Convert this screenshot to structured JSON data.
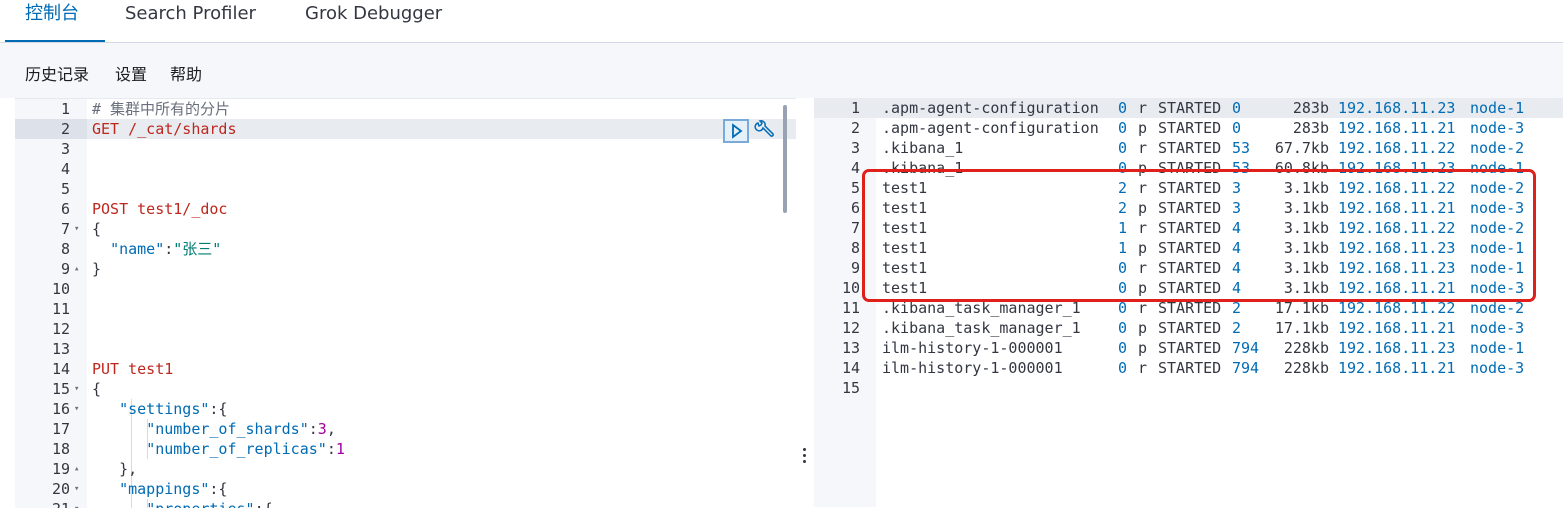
{
  "tabs": [
    {
      "label": "控制台",
      "active": true
    },
    {
      "label": "Search Profiler",
      "active": false
    },
    {
      "label": "Grok Debugger",
      "active": false
    }
  ],
  "menu": {
    "history": "历史记录",
    "settings": "设置",
    "help": "帮助"
  },
  "editor": {
    "lines": [
      {
        "n": "1",
        "fold": "",
        "tokens": [
          [
            "c-comment",
            "# 集群中所有的分片"
          ]
        ]
      },
      {
        "n": "2",
        "fold": "",
        "tokens": [
          [
            "c-method",
            "GET"
          ],
          [
            "c-punc",
            " "
          ],
          [
            "c-path",
            "/_cat/shards"
          ]
        ]
      },
      {
        "n": "3",
        "fold": "",
        "tokens": []
      },
      {
        "n": "4",
        "fold": "",
        "tokens": []
      },
      {
        "n": "5",
        "fold": "",
        "tokens": []
      },
      {
        "n": "6",
        "fold": "",
        "tokens": [
          [
            "c-method",
            "POST"
          ],
          [
            "c-punc",
            " "
          ],
          [
            "c-path",
            "test1/_doc"
          ]
        ]
      },
      {
        "n": "7",
        "fold": "▾",
        "tokens": [
          [
            "c-punc",
            "{"
          ]
        ]
      },
      {
        "n": "8",
        "fold": "",
        "tokens": [
          [
            "c-punc",
            "  "
          ],
          [
            "c-key",
            "\"name\""
          ],
          [
            "c-punc",
            ":"
          ],
          [
            "c-str",
            "\"张三\""
          ]
        ]
      },
      {
        "n": "9",
        "fold": "▴",
        "tokens": [
          [
            "c-punc",
            "}"
          ]
        ]
      },
      {
        "n": "10",
        "fold": "",
        "tokens": []
      },
      {
        "n": "11",
        "fold": "",
        "tokens": []
      },
      {
        "n": "12",
        "fold": "",
        "tokens": []
      },
      {
        "n": "13",
        "fold": "",
        "tokens": []
      },
      {
        "n": "14",
        "fold": "",
        "tokens": [
          [
            "c-method",
            "PUT"
          ],
          [
            "c-punc",
            " "
          ],
          [
            "c-path",
            "test1"
          ]
        ]
      },
      {
        "n": "15",
        "fold": "▾",
        "tokens": [
          [
            "c-punc",
            "{"
          ]
        ]
      },
      {
        "n": "16",
        "fold": "▾",
        "tokens": [
          [
            "c-punc",
            "   "
          ],
          [
            "c-key",
            "\"settings\""
          ],
          [
            "c-punc",
            ":{"
          ]
        ]
      },
      {
        "n": "17",
        "fold": "",
        "tokens": [
          [
            "c-punc",
            "      "
          ],
          [
            "c-key",
            "\"number_of_shards\""
          ],
          [
            "c-punc",
            ":"
          ],
          [
            "c-num",
            "3"
          ],
          [
            "c-punc",
            ","
          ]
        ]
      },
      {
        "n": "18",
        "fold": "",
        "tokens": [
          [
            "c-punc",
            "      "
          ],
          [
            "c-key",
            "\"number_of_replicas\""
          ],
          [
            "c-punc",
            ":"
          ],
          [
            "c-num",
            "1"
          ]
        ]
      },
      {
        "n": "19",
        "fold": "▴",
        "tokens": [
          [
            "c-punc",
            "   },"
          ]
        ]
      },
      {
        "n": "20",
        "fold": "▾",
        "tokens": [
          [
            "c-punc",
            "   "
          ],
          [
            "c-key",
            "\"mappings\""
          ],
          [
            "c-punc",
            ":{"
          ]
        ]
      },
      {
        "n": "21",
        "fold": "▾",
        "tokens": [
          [
            "c-punc",
            "      "
          ],
          [
            "c-key",
            "\"properties\""
          ],
          [
            "c-punc",
            ":{"
          ]
        ]
      }
    ]
  },
  "output": {
    "rows": [
      {
        "n": "1",
        "index": ".apm-agent-configuration",
        "shard": "0",
        "prirep": "r",
        "state": "STARTED",
        "docs": "0",
        "store": "283b",
        "ip": "192.168.11.23",
        "node": "node-1"
      },
      {
        "n": "2",
        "index": ".apm-agent-configuration",
        "shard": "0",
        "prirep": "p",
        "state": "STARTED",
        "docs": "0",
        "store": "283b",
        "ip": "192.168.11.21",
        "node": "node-3"
      },
      {
        "n": "3",
        "index": ".kibana_1",
        "shard": "0",
        "prirep": "r",
        "state": "STARTED",
        "docs": "53",
        "store": "67.7kb",
        "ip": "192.168.11.22",
        "node": "node-2"
      },
      {
        "n": "4",
        "index": ".kibana_1",
        "shard": "0",
        "prirep": "p",
        "state": "STARTED",
        "docs": "53",
        "store": "60.8kb",
        "ip": "192.168.11.23",
        "node": "node-1"
      },
      {
        "n": "5",
        "index": "test1",
        "shard": "2",
        "prirep": "r",
        "state": "STARTED",
        "docs": "3",
        "store": "3.1kb",
        "ip": "192.168.11.22",
        "node": "node-2"
      },
      {
        "n": "6",
        "index": "test1",
        "shard": "2",
        "prirep": "p",
        "state": "STARTED",
        "docs": "3",
        "store": "3.1kb",
        "ip": "192.168.11.21",
        "node": "node-3"
      },
      {
        "n": "7",
        "index": "test1",
        "shard": "1",
        "prirep": "r",
        "state": "STARTED",
        "docs": "4",
        "store": "3.1kb",
        "ip": "192.168.11.22",
        "node": "node-2"
      },
      {
        "n": "8",
        "index": "test1",
        "shard": "1",
        "prirep": "p",
        "state": "STARTED",
        "docs": "4",
        "store": "3.1kb",
        "ip": "192.168.11.23",
        "node": "node-1"
      },
      {
        "n": "9",
        "index": "test1",
        "shard": "0",
        "prirep": "r",
        "state": "STARTED",
        "docs": "4",
        "store": "3.1kb",
        "ip": "192.168.11.23",
        "node": "node-1"
      },
      {
        "n": "10",
        "index": "test1",
        "shard": "0",
        "prirep": "p",
        "state": "STARTED",
        "docs": "4",
        "store": "3.1kb",
        "ip": "192.168.11.21",
        "node": "node-3"
      },
      {
        "n": "11",
        "index": ".kibana_task_manager_1",
        "shard": "0",
        "prirep": "r",
        "state": "STARTED",
        "docs": "2",
        "store": "17.1kb",
        "ip": "192.168.11.22",
        "node": "node-2"
      },
      {
        "n": "12",
        "index": ".kibana_task_manager_1",
        "shard": "0",
        "prirep": "p",
        "state": "STARTED",
        "docs": "2",
        "store": "17.1kb",
        "ip": "192.168.11.21",
        "node": "node-3"
      },
      {
        "n": "13",
        "index": "ilm-history-1-000001",
        "shard": "0",
        "prirep": "p",
        "state": "STARTED",
        "docs": "794",
        "store": "228kb",
        "ip": "192.168.11.23",
        "node": "node-1"
      },
      {
        "n": "14",
        "index": "ilm-history-1-000001",
        "shard": "0",
        "prirep": "r",
        "state": "STARTED",
        "docs": "794",
        "store": "228kb",
        "ip": "192.168.11.21",
        "node": "node-3"
      },
      {
        "n": "15",
        "index": "",
        "shard": "",
        "prirep": "",
        "state": "",
        "docs": "",
        "store": "",
        "ip": "",
        "node": ""
      }
    ]
  },
  "colors": {
    "accent": "#006bb4",
    "highlight_box": "#e0201b"
  },
  "icons": {
    "run": "play-icon",
    "settings": "wrench-icon"
  }
}
